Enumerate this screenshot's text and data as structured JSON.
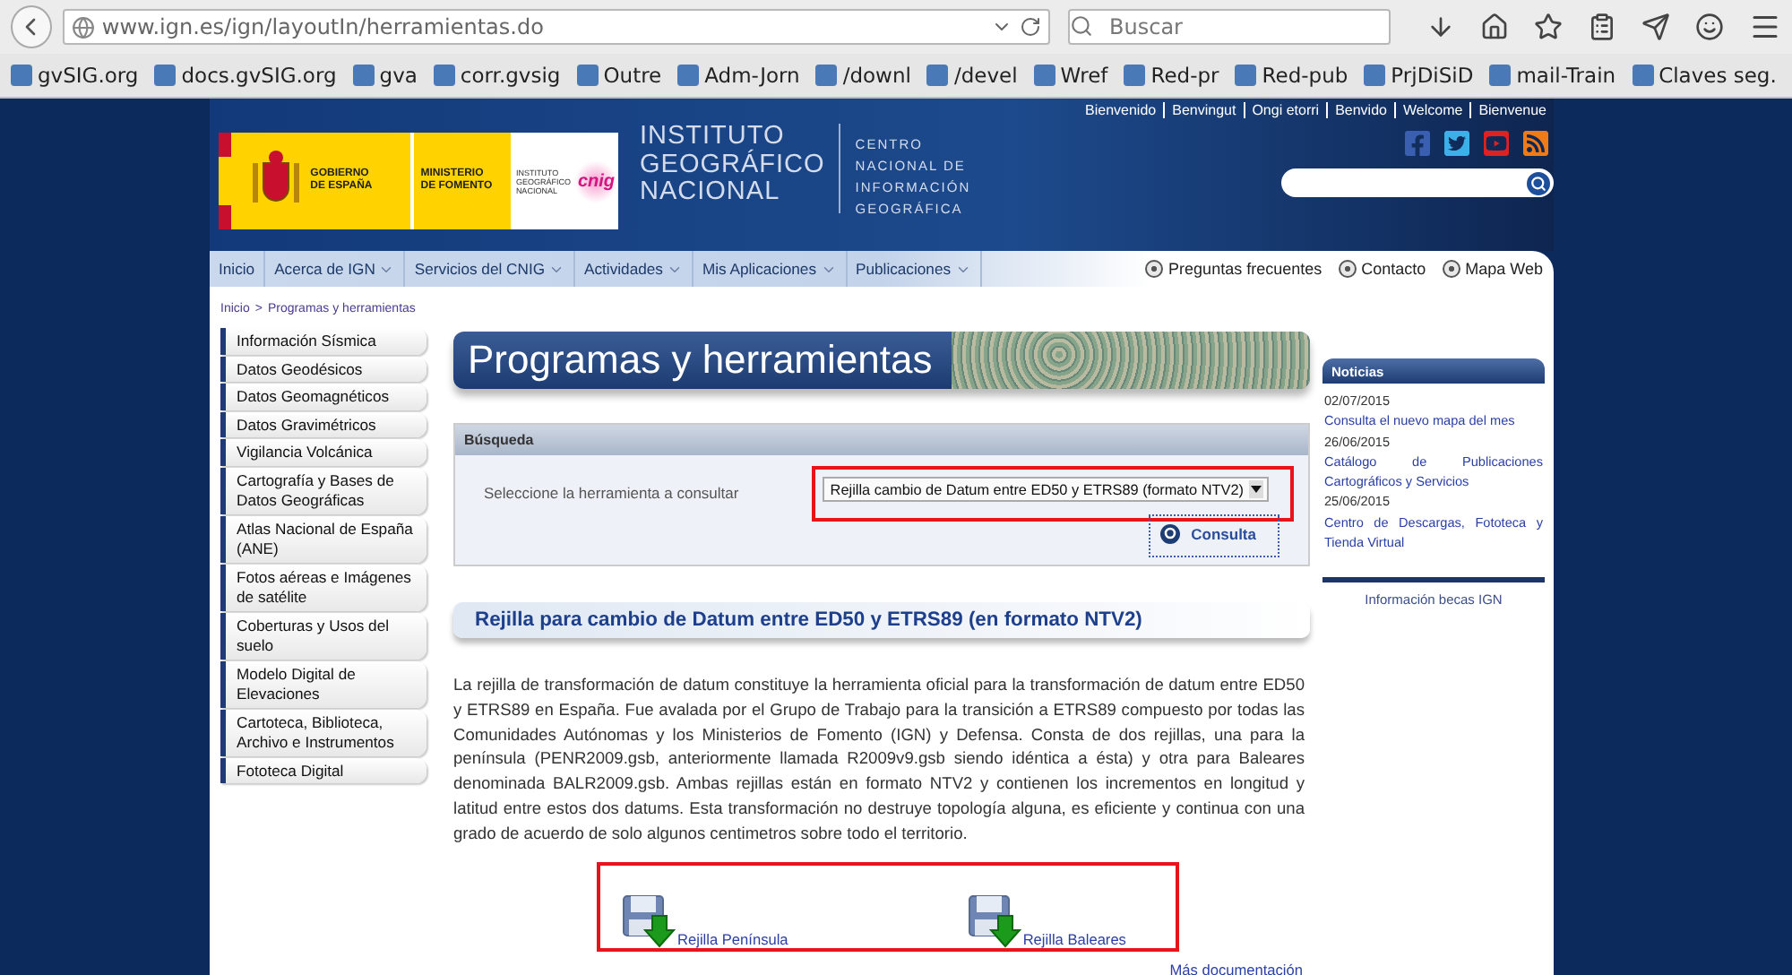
{
  "browser": {
    "url": "www.ign.es/ign/layoutIn/herramientas.do",
    "search": {
      "placeholder": "Buscar"
    },
    "bookmarks": [
      {
        "label": "gvSIG.org"
      },
      {
        "label": "docs.gvSIG.org"
      },
      {
        "label": "gva"
      },
      {
        "label": "corr.gvsig"
      },
      {
        "label": "Outre"
      },
      {
        "label": "Adm-Jorn"
      },
      {
        "label": "/downl"
      },
      {
        "label": "/devel"
      },
      {
        "label": "Wref"
      },
      {
        "label": "Red-pr"
      },
      {
        "label": "Red-pub"
      },
      {
        "label": "PrjDiSiD"
      },
      {
        "label": "mail-Train"
      },
      {
        "label": "Claves seg."
      }
    ]
  },
  "header": {
    "languages": [
      "Bienvenido",
      "Benvingut",
      "Ongi etorri",
      "Benvido",
      "Welcome",
      "Bienvenue"
    ],
    "logo": {
      "government": [
        "GOBIERNO",
        "DE ESPAÑA"
      ],
      "ministry": [
        "MINISTERIO",
        "DE FOMENTO"
      ],
      "institute_small": [
        "INSTITUTO",
        "GEOGRÁFICO",
        "NACIONAL"
      ],
      "cnig": "cnig"
    },
    "institute": [
      "INSTITUTO",
      "GEOGRÁFICO",
      "NACIONAL"
    ],
    "centre": [
      "CENTRO",
      "NACIONAL DE",
      "INFORMACIÓN",
      "GEOGRÁFICA"
    ]
  },
  "nav": {
    "items": [
      {
        "label": "Inicio",
        "has_menu": false
      },
      {
        "label": "Acerca de IGN",
        "has_menu": true
      },
      {
        "label": "Servicios del CNIG",
        "has_menu": true
      },
      {
        "label": "Actividades",
        "has_menu": true
      },
      {
        "label": "Mis Aplicaciones",
        "has_menu": true
      },
      {
        "label": "Publicaciones",
        "has_menu": true
      }
    ],
    "links": [
      "Preguntas frecuentes",
      "Contacto",
      "Mapa Web"
    ]
  },
  "breadcrumb": {
    "home": "Inicio",
    "separator": ">",
    "current": "Programas y herramientas"
  },
  "sidebar": {
    "items": [
      "Información Sísmica",
      "Datos Geodésicos",
      "Datos Geomagnéticos",
      "Datos Gravimétricos",
      "Vigilancia Volcánica",
      "Cartografía y Bases de Datos Geográficas",
      "Atlas Nacional de España (ANE)",
      "Fotos aéreas e Imágenes de satélite",
      "Coberturas y Usos del suelo",
      "Modelo Digital de Elevaciones",
      "Cartoteca, Biblioteca, Archivo e Instrumentos",
      "Fototeca Digital"
    ]
  },
  "page_title": "Programas y herramientas",
  "search_panel": {
    "title": "Búsqueda",
    "label": "Seleccione la herramienta a consultar",
    "select_value": "Rejilla cambio de Datum entre ED50 y ETRS89 (formato NTV2)",
    "button": "Consulta"
  },
  "section_title": "Rejilla para cambio de Datum entre ED50 y ETRS89 (en formato NTV2)",
  "description": "La rejilla de transformación de datum constituye la herramienta oficial para la transformación de datum entre ED50 y ETRS89 en España. Fue avalada por el Grupo de Trabajo para la transición a ETRS89 compuesto por todas las Comunidades Autónomas y los Ministerios de Fomento (IGN) y Defensa. Consta de dos rejillas, una para la península (PENR2009.gsb, anteriormente llamada R2009v9.gsb siendo idéntica a ésta) y otra para Baleares denominada BALR2009.gsb. Ambas rejillas están en formato NTV2 y contienen los incrementos en longitud y latitud entre estos dos datums. Esta transformación no destruye topología alguna, es eficiente y continua con una grado de acuerdo de solo algunos centimetros sobre todo el territorio.",
  "downloads": [
    "Rejilla Península",
    "Rejilla Baleares"
  ],
  "more_link": "Más documentación",
  "news": {
    "title": "Noticias",
    "items": [
      {
        "date": "02/07/2015",
        "link": "Consulta el nuevo mapa del mes"
      },
      {
        "date": "26/06/2015",
        "link": "Catálogo de Publicaciones Cartográficos y Servicios"
      },
      {
        "date": "25/06/2015",
        "link": "Centro de Descargas, Fototeca y Tienda Virtual"
      }
    ],
    "footer_link": "Información becas IGN"
  }
}
